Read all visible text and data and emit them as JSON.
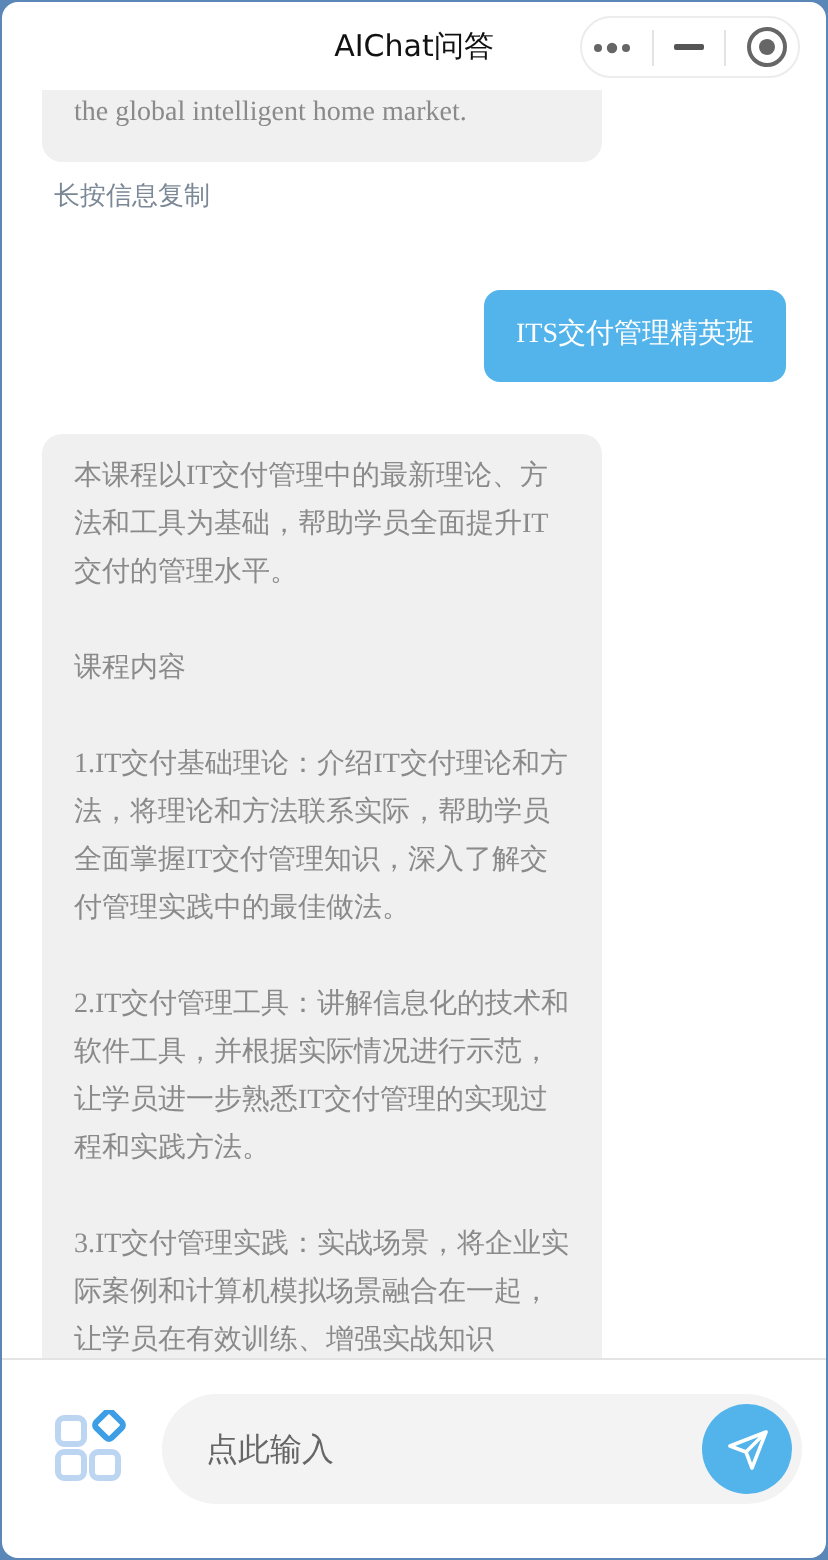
{
  "window": {
    "title": "AIChat问答"
  },
  "messages": [
    {
      "kind": "bot",
      "paragraphs": [
        "the global intelligent home market."
      ],
      "hint": "长按信息复制"
    },
    {
      "kind": "user",
      "paragraphs": [
        "ITS交付管理精英班"
      ]
    },
    {
      "kind": "bot",
      "paragraphs": [
        "本课程以IT交付管理中的最新理论、方法和工具为基础，帮助学员全面提升IT交付的管理水平。",
        "课程内容",
        "1.IT交付基础理论：介绍IT交付理论和方法，将理论和方法联系实际，帮助学员全面掌握IT交付管理知识，深入了解交付管理实践中的最佳做法。",
        "2.IT交付管理工具：讲解信息化的技术和软件工具，并根据实际情况进行示范，让学员进一步熟悉IT交付管理的实现过程和实践方法。",
        "3.IT交付管理实践：实战场景，将企业实际案例和计算机模拟场景融合在一起，让学员在有效训练、增强实战知识"
      ]
    }
  ],
  "input": {
    "placeholder": "点此输入"
  }
}
